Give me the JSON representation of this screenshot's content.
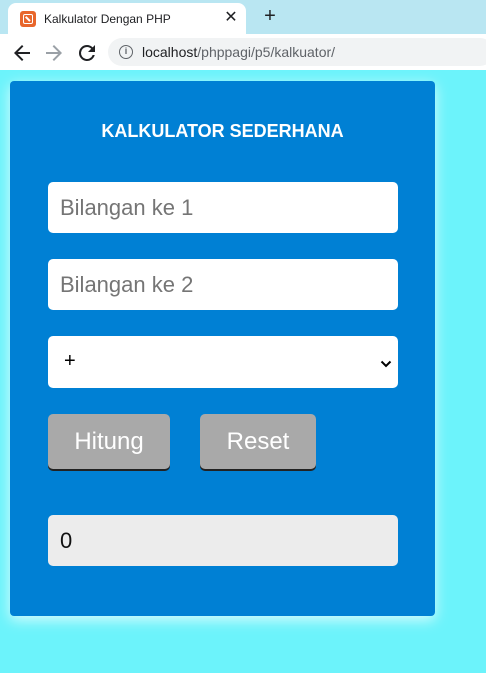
{
  "browser": {
    "tab_title": "Kalkulator Dengan PHP",
    "tab_close": "✕",
    "new_tab": "+",
    "url_host": "localhost",
    "url_path": "/phppagi/p5/kalkuator/"
  },
  "calculator": {
    "title": "KALKULATOR SEDERHANA",
    "input1_placeholder": "Bilangan ke 1",
    "input2_placeholder": "Bilangan ke 2",
    "operator_selected": "+",
    "hitung_label": "Hitung",
    "reset_label": "Reset",
    "result_value": "0"
  },
  "colors": {
    "page_background": "#6cf3fb",
    "card_background": "#0080d4",
    "button_background": "#a9a9a9",
    "result_background": "#ececec"
  }
}
